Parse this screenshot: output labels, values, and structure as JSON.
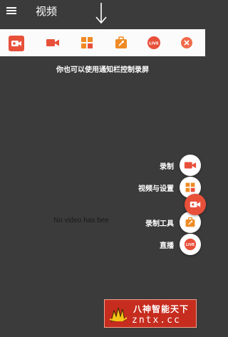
{
  "app": {
    "title": "视频",
    "menu_icon": "menu-icon"
  },
  "notification_bar": {
    "items": [
      {
        "name": "recorder-app-icon",
        "color": "#e8503a"
      },
      {
        "name": "record-video-icon",
        "color": "#e8503a"
      },
      {
        "name": "grid-tools-icon",
        "color": "#f08a24"
      },
      {
        "name": "toolbox-icon",
        "color": "#f08a24"
      },
      {
        "name": "live-icon",
        "color": "#e8503a",
        "text": "LIVE"
      },
      {
        "name": "close-icon",
        "color": "#f06a4a"
      }
    ]
  },
  "hint_text": "你也可以使用通知栏控制录屏",
  "empty_message": "No video has bee",
  "fab_menu": {
    "record": {
      "label": "录制",
      "icon": "video-camera-icon"
    },
    "videos_settings": {
      "label": "视频与设置",
      "icon": "grid-icon"
    },
    "tools": {
      "label": "录制工具",
      "icon": "toolbox-icon"
    },
    "live": {
      "label": "直播",
      "icon": "live-icon",
      "icon_text": "LIVE"
    }
  },
  "floating_bubble": {
    "icon": "recorder-bubble-icon"
  },
  "watermark": {
    "line1": "八神智能天下",
    "line2": "zntx.cc"
  },
  "colors": {
    "background": "#3b3b3b",
    "accent_red": "#e8503a",
    "accent_orange": "#f08a24"
  }
}
